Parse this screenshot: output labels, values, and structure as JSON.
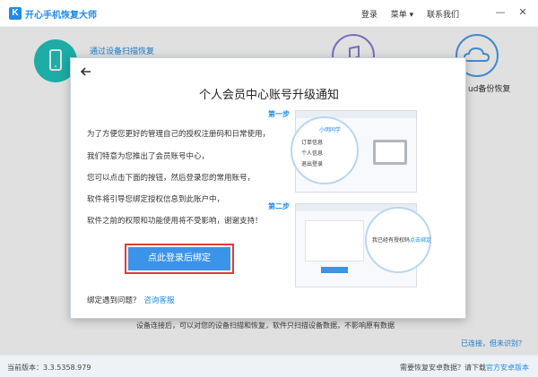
{
  "app": {
    "title": "开心手机恢复大师",
    "logo_letter": "K",
    "nav": {
      "login": "登录",
      "menu": "菜单 ▾",
      "contact": "联系我们"
    },
    "window_controls": {
      "minimize": "—",
      "close": "✕"
    }
  },
  "features": {
    "scan_device": "通过设备扫描恢复",
    "icloud_backup": "ud备份恢复"
  },
  "background": {
    "note": "设备连接后，可以对您的设备扫描和恢复，软件只扫描设备数据，不影响原有数据",
    "connected_link": "已连接，但未识别？"
  },
  "statusbar": {
    "version": "当前版本：3.3.5358.979",
    "android_prefix": "需要恢复安卓数据？请下载",
    "android_link": "官方安卓版本"
  },
  "dialog": {
    "title": "个人会员中心账号升级通知",
    "paragraphs": [
      "为了方便您更好的管理自己的授权注册码和日常使用，",
      "我们特意为您推出了会员账号中心，",
      "您可以点击下面的按钮，然后登录您的常用账号，",
      "软件将引导您绑定授权信息到此账户中，",
      "软件之前的权限和功能使用将不受影响，谢谢支持！"
    ],
    "bind_button": "点此登录后绑定",
    "help_text": "绑定遇到问题？",
    "help_link": "咨询客服",
    "step1_label": "第一步",
    "step2_label": "第二步",
    "step1_menu": [
      "订单信息",
      "个人信息",
      "退出登录"
    ],
    "step1_badge": "小明同学",
    "step2_text": "我已经有授权码",
    "step2_link": "点击绑定"
  },
  "colors": {
    "accent": "#1f8ce6",
    "button": "#3b93ea",
    "highlight": "#e53935",
    "scan_icon": "#21c4bd",
    "music_icon": "#8f7ad6",
    "cloud_icon": "#4a9ee8"
  },
  "icons": {
    "logo": "k-logo-icon",
    "phone": "phone-icon",
    "music": "music-note-icon",
    "cloud": "cloud-icon",
    "back": "arrow-left-icon",
    "close": "close-icon",
    "minimize": "minimize-icon"
  }
}
